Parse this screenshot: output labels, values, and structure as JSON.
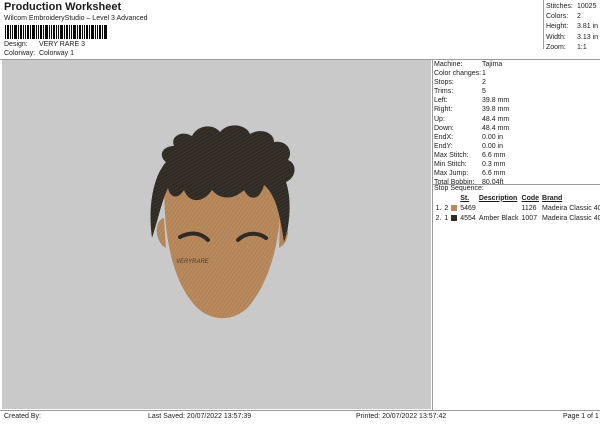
{
  "header": {
    "title": "Production Worksheet",
    "subtitle": "Wilcom EmbroideryStudio – Level 3 Advanced"
  },
  "design_info": [
    {
      "label": "Design:",
      "value": "VERY RARE 3"
    },
    {
      "label": "Colorway:",
      "value": "Colorway 1"
    }
  ],
  "stats": [
    {
      "label": "Stitches:",
      "value": "10025"
    },
    {
      "label": "Colors:",
      "value": "2"
    },
    {
      "label": "Height:",
      "value": "3.81 in"
    },
    {
      "label": "Width:",
      "value": "3.13 in"
    },
    {
      "label": "Zoom:",
      "value": "1:1"
    }
  ],
  "machine_info": [
    {
      "label": "Machine:",
      "value": "Tajima"
    },
    {
      "label": "Color changes:",
      "value": "1"
    },
    {
      "label": "Stops:",
      "value": "2"
    },
    {
      "label": "Trims:",
      "value": "5"
    },
    {
      "label": "Left:",
      "value": "39.8 mm"
    },
    {
      "label": "Right:",
      "value": "39.8 mm"
    },
    {
      "label": "Up:",
      "value": "48.4 mm"
    },
    {
      "label": "Down:",
      "value": "48.4 mm"
    },
    {
      "label": "EndX:",
      "value": "0.00 in"
    },
    {
      "label": "EndY:",
      "value": "0.00 in"
    },
    {
      "label": "Max Stitch:",
      "value": "6.6 mm"
    },
    {
      "label": "Min Stitch:",
      "value": "0.3 mm"
    },
    {
      "label": "Max Jump:",
      "value": "6.6 mm"
    },
    {
      "label": "Total Bobbin:",
      "value": "80.04ft"
    }
  ],
  "stop_sequence": {
    "title": "Stop Sequence:",
    "headers": {
      "st": "St.",
      "description": "Description",
      "code": "Code",
      "brand": "Brand"
    },
    "rows": [
      {
        "index": "1.",
        "stop": "2",
        "color": "#b98a5e",
        "st": "5469",
        "description": "",
        "code": "1126",
        "brand": "Madeira Classic 40"
      },
      {
        "index": "2.",
        "stop": "1",
        "color": "#2f2a24",
        "st": "4554",
        "description": "Amber Black",
        "code": "1007",
        "brand": "Madeira Classic 40"
      }
    ]
  },
  "artwork": {
    "signature_text": "VERYRARE",
    "background_color": "#c9c9c9",
    "skin_color": "#b98a5e",
    "hair_color": "#2f2a24"
  },
  "footer": {
    "created_by": "Created By:",
    "last_saved": "Last Saved: 20/07/2022 13:57:39",
    "printed": "Printed: 20/07/2022 13:57:42",
    "page": "Page 1 of 1"
  }
}
